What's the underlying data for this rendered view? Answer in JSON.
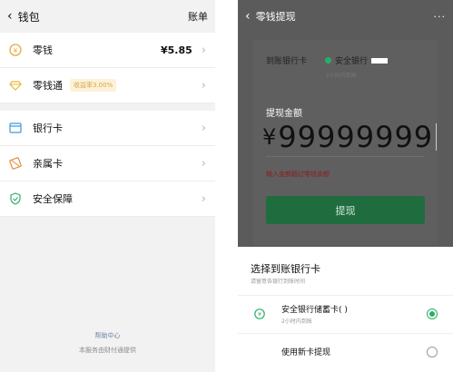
{
  "left": {
    "header": {
      "title": "钱包",
      "bill": "账单"
    },
    "rows": {
      "change": {
        "label": "零钱",
        "value": "¥5.85"
      },
      "licaitong": {
        "label": "零钱通",
        "badge": "收益率3.00%"
      },
      "bank_card": {
        "label": "银行卡"
      },
      "family_card": {
        "label": "亲属卡"
      },
      "security": {
        "label": "安全保障"
      }
    },
    "footer": {
      "help": "帮助中心",
      "provider": "本服务由财付通提供"
    }
  },
  "right": {
    "header": {
      "title": "零钱提现"
    },
    "arrival_label": "到账银行卡",
    "bank_name": "安全银行",
    "arrival_time": "2小时内到账",
    "amount_label": "提现金额",
    "currency_symbol": "¥",
    "amount_value": "99999999",
    "error": "输入金额超过零钱余额",
    "withdraw_button": "提现",
    "sheet": {
      "title": "选择到账银行卡",
      "subtitle": "请留意各银行到账时间",
      "options": [
        {
          "name": "安全银行储蓄卡(    )",
          "time": "2小时内到账",
          "selected": true
        },
        {
          "name": "使用新卡提现",
          "time": "",
          "selected": false
        }
      ]
    }
  },
  "colors": {
    "accent": "#2aae67",
    "error": "#8a1c1c",
    "badge": "#d9a44a"
  }
}
